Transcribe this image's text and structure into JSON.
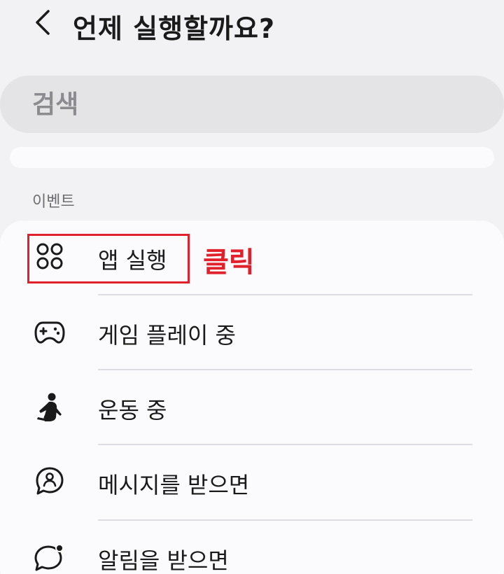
{
  "header": {
    "title": "언제 실행할까요?",
    "back_icon": "chevron-left-icon"
  },
  "search": {
    "placeholder": "검색",
    "value": ""
  },
  "section": {
    "label": "이벤트"
  },
  "items": [
    {
      "label": "앱 실행",
      "icon": "app-grid-icon"
    },
    {
      "label": "게임 플레이 중",
      "icon": "gamepad-icon"
    },
    {
      "label": "운동 중",
      "icon": "running-person-icon"
    },
    {
      "label": "메시지를 받으면",
      "icon": "message-contact-icon"
    },
    {
      "label": "알림을 받으면",
      "icon": "notification-bubble-icon"
    }
  ],
  "annotation": {
    "text": "클릭",
    "color": "#e0202a"
  },
  "colors": {
    "background": "#f2f2f4",
    "card": "#fbfbfd",
    "search_bg": "#e4e4e7",
    "text": "#1a1a1a",
    "highlight": "#e0202a"
  }
}
